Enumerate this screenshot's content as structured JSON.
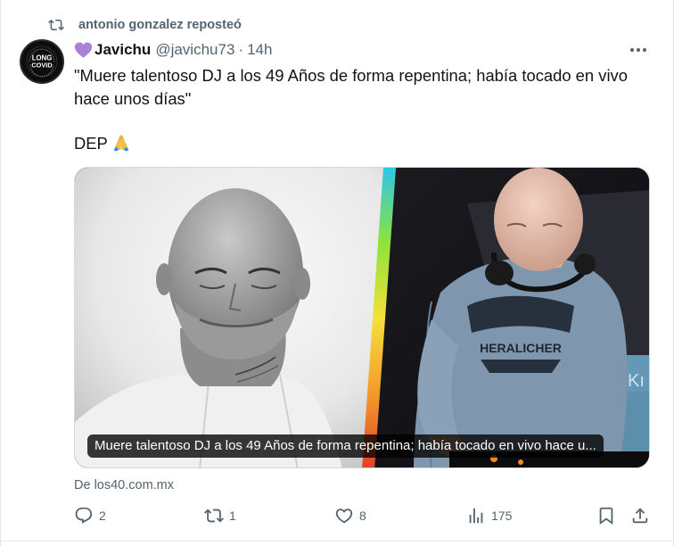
{
  "repost": {
    "icon": "repost-icon",
    "text": "antonio gonzalez reposteó"
  },
  "author": {
    "avatar_text_top": "LONG",
    "avatar_text_bottom": "COVID",
    "avatar_ring_text": "AWARENESS",
    "name": "Javichu",
    "name_emoji": "purple-heart-icon",
    "handle": "@javichu73",
    "separator": "·",
    "time": "14h"
  },
  "tweet": {
    "line1": "\"Muere talentoso DJ a los 49 Años de forma repentina; había tocado en vivo hace unos días\"",
    "line2": "DEP"
  },
  "media": {
    "caption": "Muere talentoso DJ a los 49 Años de forma repentina; había tocado en vivo hace u...",
    "shirt_text": "HERALICHER"
  },
  "source": {
    "text": "De los40.com.mx"
  },
  "actions": {
    "replies": "2",
    "reposts": "1",
    "likes": "8",
    "views": "175"
  },
  "colors": {
    "secondary_text": "#536471",
    "primary_text": "#0f1419",
    "heart": "#a880d8"
  }
}
